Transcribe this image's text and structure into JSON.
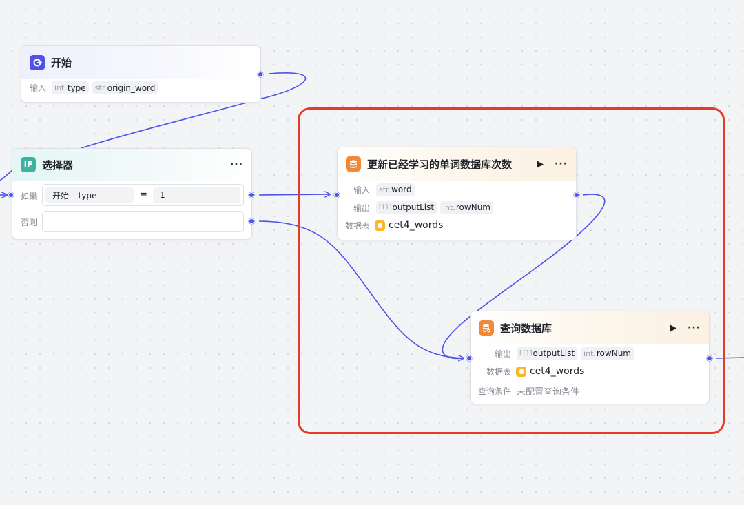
{
  "colors": {
    "edge": "#4d53e8",
    "highlight": "#e33d27",
    "start_icon": "#4d53e8",
    "selector_icon": "#3bb3a3",
    "db_icon": "#f0883a",
    "table_icon": "#fcb62a"
  },
  "start_node": {
    "title": "开始",
    "icon": "start-icon",
    "input_label": "输入",
    "params": [
      {
        "type": "int.",
        "name": "type"
      },
      {
        "type": "str.",
        "name": "origin_word"
      }
    ]
  },
  "selector_node": {
    "title": "选择器",
    "icon_text": "IF",
    "more": "···",
    "if_label": "如果",
    "else_label": "否则",
    "condition": {
      "left": "开始  –  type",
      "operator": "=",
      "right": "1"
    }
  },
  "update_node": {
    "title": "更新已经学习的单词数据库次数",
    "icon": "database-icon",
    "more": "···",
    "input_label": "输入",
    "inputs": [
      {
        "type": "str.",
        "name": "word"
      }
    ],
    "output_label": "输出",
    "outputs": [
      {
        "type": "[{}]",
        "name": "outputList"
      },
      {
        "type": "int.",
        "name": "rowNum"
      }
    ],
    "table_label": "数据表",
    "table": "cet4_words"
  },
  "query_node": {
    "title": "查询数据库",
    "icon": "database-search-icon",
    "more": "···",
    "output_label": "输出",
    "outputs": [
      {
        "type": "[{}]",
        "name": "outputList"
      },
      {
        "type": "int.",
        "name": "rowNum"
      }
    ],
    "table_label": "数据表",
    "table": "cet4_words",
    "cond_label": "查询条件",
    "cond_value": "未配置查询条件"
  }
}
